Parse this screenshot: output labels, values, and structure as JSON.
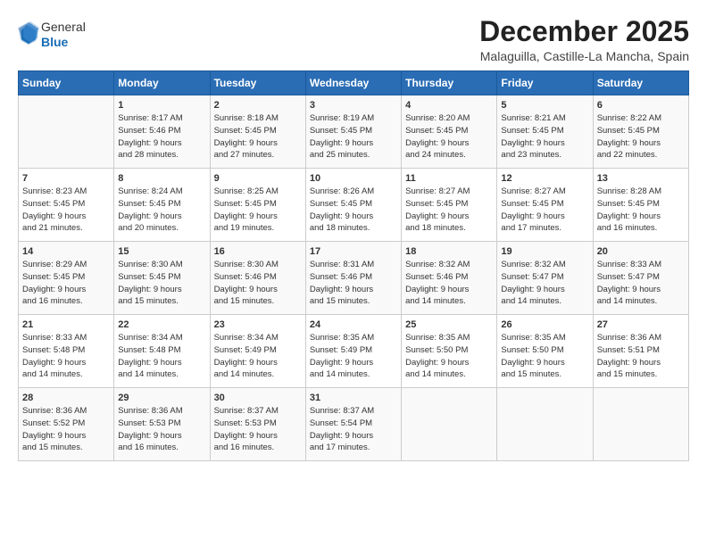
{
  "logo": {
    "general": "General",
    "blue": "Blue"
  },
  "title": "December 2025",
  "subtitle": "Malaguilla, Castille-La Mancha, Spain",
  "headers": [
    "Sunday",
    "Monday",
    "Tuesday",
    "Wednesday",
    "Thursday",
    "Friday",
    "Saturday"
  ],
  "weeks": [
    [
      {
        "day": "",
        "info": ""
      },
      {
        "day": "1",
        "info": "Sunrise: 8:17 AM\nSunset: 5:46 PM\nDaylight: 9 hours\nand 28 minutes."
      },
      {
        "day": "2",
        "info": "Sunrise: 8:18 AM\nSunset: 5:45 PM\nDaylight: 9 hours\nand 27 minutes."
      },
      {
        "day": "3",
        "info": "Sunrise: 8:19 AM\nSunset: 5:45 PM\nDaylight: 9 hours\nand 25 minutes."
      },
      {
        "day": "4",
        "info": "Sunrise: 8:20 AM\nSunset: 5:45 PM\nDaylight: 9 hours\nand 24 minutes."
      },
      {
        "day": "5",
        "info": "Sunrise: 8:21 AM\nSunset: 5:45 PM\nDaylight: 9 hours\nand 23 minutes."
      },
      {
        "day": "6",
        "info": "Sunrise: 8:22 AM\nSunset: 5:45 PM\nDaylight: 9 hours\nand 22 minutes."
      }
    ],
    [
      {
        "day": "7",
        "info": "Sunrise: 8:23 AM\nSunset: 5:45 PM\nDaylight: 9 hours\nand 21 minutes."
      },
      {
        "day": "8",
        "info": "Sunrise: 8:24 AM\nSunset: 5:45 PM\nDaylight: 9 hours\nand 20 minutes."
      },
      {
        "day": "9",
        "info": "Sunrise: 8:25 AM\nSunset: 5:45 PM\nDaylight: 9 hours\nand 19 minutes."
      },
      {
        "day": "10",
        "info": "Sunrise: 8:26 AM\nSunset: 5:45 PM\nDaylight: 9 hours\nand 18 minutes."
      },
      {
        "day": "11",
        "info": "Sunrise: 8:27 AM\nSunset: 5:45 PM\nDaylight: 9 hours\nand 18 minutes."
      },
      {
        "day": "12",
        "info": "Sunrise: 8:27 AM\nSunset: 5:45 PM\nDaylight: 9 hours\nand 17 minutes."
      },
      {
        "day": "13",
        "info": "Sunrise: 8:28 AM\nSunset: 5:45 PM\nDaylight: 9 hours\nand 16 minutes."
      }
    ],
    [
      {
        "day": "14",
        "info": "Sunrise: 8:29 AM\nSunset: 5:45 PM\nDaylight: 9 hours\nand 16 minutes."
      },
      {
        "day": "15",
        "info": "Sunrise: 8:30 AM\nSunset: 5:45 PM\nDaylight: 9 hours\nand 15 minutes."
      },
      {
        "day": "16",
        "info": "Sunrise: 8:30 AM\nSunset: 5:46 PM\nDaylight: 9 hours\nand 15 minutes."
      },
      {
        "day": "17",
        "info": "Sunrise: 8:31 AM\nSunset: 5:46 PM\nDaylight: 9 hours\nand 15 minutes."
      },
      {
        "day": "18",
        "info": "Sunrise: 8:32 AM\nSunset: 5:46 PM\nDaylight: 9 hours\nand 14 minutes."
      },
      {
        "day": "19",
        "info": "Sunrise: 8:32 AM\nSunset: 5:47 PM\nDaylight: 9 hours\nand 14 minutes."
      },
      {
        "day": "20",
        "info": "Sunrise: 8:33 AM\nSunset: 5:47 PM\nDaylight: 9 hours\nand 14 minutes."
      }
    ],
    [
      {
        "day": "21",
        "info": "Sunrise: 8:33 AM\nSunset: 5:48 PM\nDaylight: 9 hours\nand 14 minutes."
      },
      {
        "day": "22",
        "info": "Sunrise: 8:34 AM\nSunset: 5:48 PM\nDaylight: 9 hours\nand 14 minutes."
      },
      {
        "day": "23",
        "info": "Sunrise: 8:34 AM\nSunset: 5:49 PM\nDaylight: 9 hours\nand 14 minutes."
      },
      {
        "day": "24",
        "info": "Sunrise: 8:35 AM\nSunset: 5:49 PM\nDaylight: 9 hours\nand 14 minutes."
      },
      {
        "day": "25",
        "info": "Sunrise: 8:35 AM\nSunset: 5:50 PM\nDaylight: 9 hours\nand 14 minutes."
      },
      {
        "day": "26",
        "info": "Sunrise: 8:35 AM\nSunset: 5:50 PM\nDaylight: 9 hours\nand 15 minutes."
      },
      {
        "day": "27",
        "info": "Sunrise: 8:36 AM\nSunset: 5:51 PM\nDaylight: 9 hours\nand 15 minutes."
      }
    ],
    [
      {
        "day": "28",
        "info": "Sunrise: 8:36 AM\nSunset: 5:52 PM\nDaylight: 9 hours\nand 15 minutes."
      },
      {
        "day": "29",
        "info": "Sunrise: 8:36 AM\nSunset: 5:53 PM\nDaylight: 9 hours\nand 16 minutes."
      },
      {
        "day": "30",
        "info": "Sunrise: 8:37 AM\nSunset: 5:53 PM\nDaylight: 9 hours\nand 16 minutes."
      },
      {
        "day": "31",
        "info": "Sunrise: 8:37 AM\nSunset: 5:54 PM\nDaylight: 9 hours\nand 17 minutes."
      },
      {
        "day": "",
        "info": ""
      },
      {
        "day": "",
        "info": ""
      },
      {
        "day": "",
        "info": ""
      }
    ]
  ]
}
